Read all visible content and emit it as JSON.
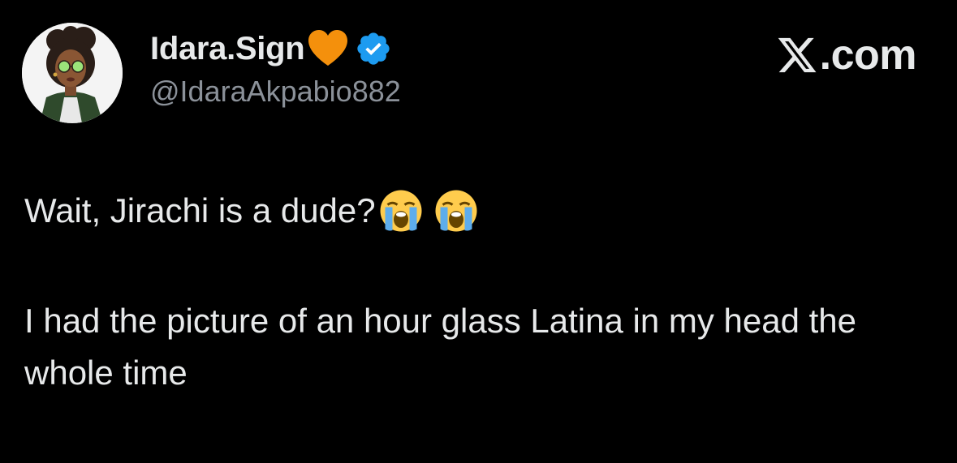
{
  "author": {
    "display_name": "Idara.Sign",
    "handle": "@IdaraAkpabio882",
    "name_emoji": "orange-heart-icon",
    "verified_badge": "verified-badge-icon"
  },
  "brand": {
    "text": ".com",
    "logo": "x-logo-icon"
  },
  "tweet": {
    "line1_text": "Wait, Jirachi is a dude?",
    "emojis": [
      "loudly-crying-face-icon",
      "loudly-crying-face-icon"
    ],
    "paragraph2": "I had the picture of an hour glass Latina in my head the whole time"
  },
  "colors": {
    "background": "#000000",
    "text_primary": "#e7e9ea",
    "text_secondary": "#8b9199",
    "verified_blue": "#1d9bf0",
    "heart_orange": "#f4900c"
  }
}
